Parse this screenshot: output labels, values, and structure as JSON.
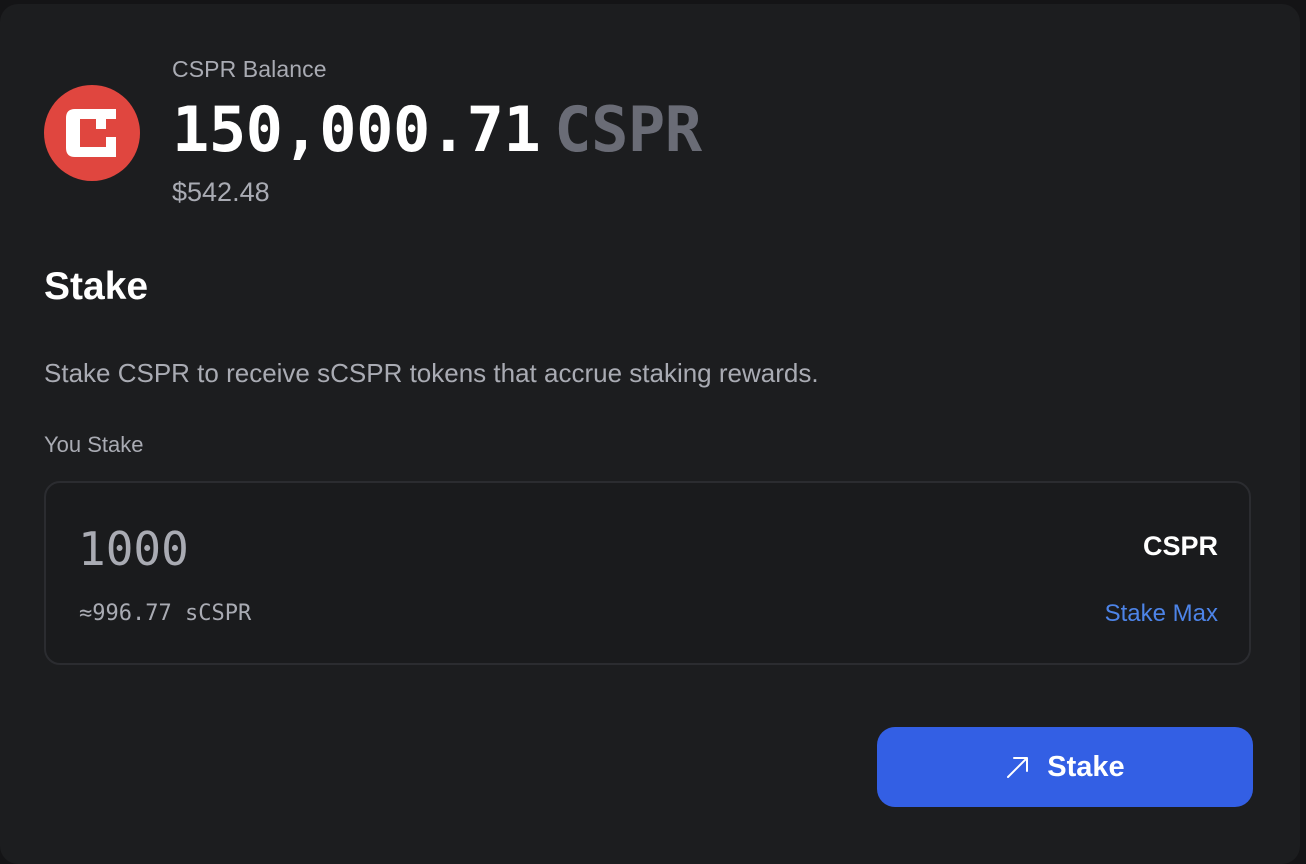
{
  "balance": {
    "label": "CSPR Balance",
    "amount": "150,000.71",
    "unit": "CSPR",
    "usd_value": "$542.48",
    "logo_icon": "casper-logo-icon"
  },
  "stake": {
    "title": "Stake",
    "description": "Stake CSPR to receive sCSPR tokens that accrue staking rewards.",
    "input_label": "You Stake",
    "input_value": "",
    "input_placeholder": "1000",
    "input_unit": "CSPR",
    "estimate": "≈996.77 sCSPR",
    "max_label": "Stake Max",
    "button_label": "Stake",
    "button_icon": "arrow-up-right-icon"
  },
  "colors": {
    "background": "#1c1d1f",
    "logo": "#e0463f",
    "accent": "#335fe4",
    "link": "#4d84e8"
  }
}
